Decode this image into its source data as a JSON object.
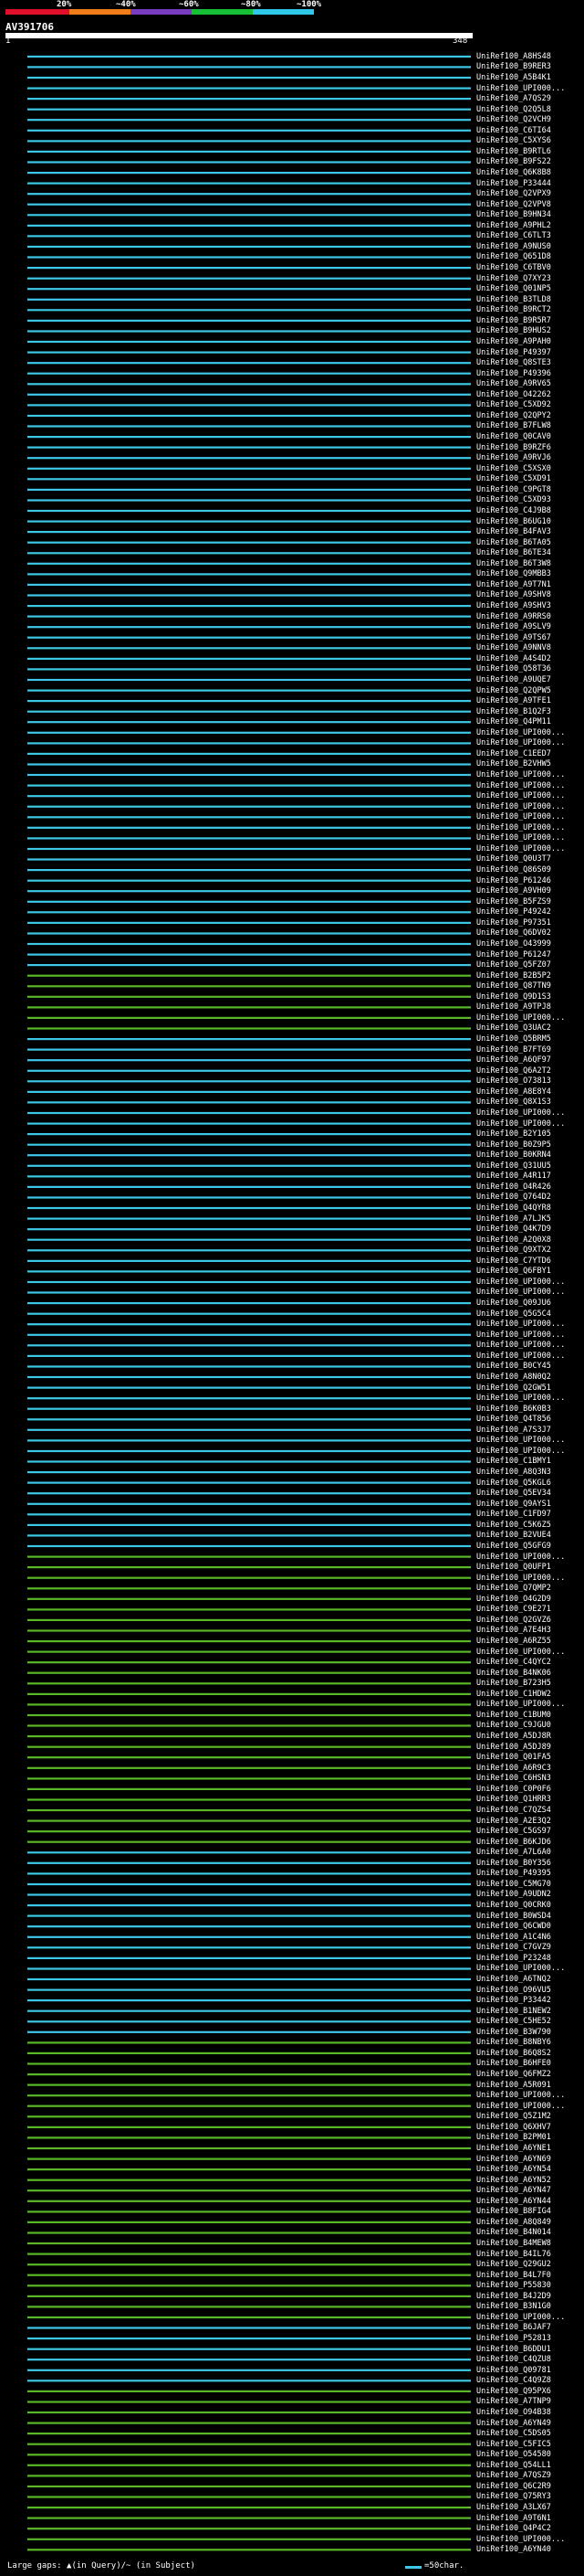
{
  "header": {
    "percent_labels": [
      "20%",
      "~40%",
      "~60%",
      "~80%",
      "~100%"
    ],
    "percent_colors": [
      "#e0102a",
      "#f07c1a",
      "#7a3cbf",
      "#18c038",
      "#30c8e8"
    ],
    "query_id": "AV391706",
    "start_tick": "1",
    "end_tick": "348"
  },
  "colors": {
    "cyan": "#3cc8e6",
    "green": "#5ab828",
    "background": "#000000"
  },
  "hits": [
    {
      "label": "UniRef100_A8HS48",
      "color": "cyan"
    },
    {
      "label": "UniRef100_B9RER3",
      "color": "cyan"
    },
    {
      "label": "UniRef100_A5B4K1",
      "color": "cyan"
    },
    {
      "label": "UniRef100_UPI000...",
      "color": "cyan"
    },
    {
      "label": "UniRef100_A7QS29",
      "color": "cyan"
    },
    {
      "label": "UniRef100_Q2Q5L8",
      "color": "cyan"
    },
    {
      "label": "UniRef100_Q2VCH9",
      "color": "cyan"
    },
    {
      "label": "UniRef100_C6TI64",
      "color": "cyan"
    },
    {
      "label": "UniRef100_C5XYS6",
      "color": "cyan"
    },
    {
      "label": "UniRef100_B9RTL6",
      "color": "cyan"
    },
    {
      "label": "UniRef100_B9FS22",
      "color": "cyan"
    },
    {
      "label": "UniRef100_Q6K8B8",
      "color": "cyan"
    },
    {
      "label": "UniRef100_P33444",
      "color": "cyan"
    },
    {
      "label": "UniRef100_Q2VPX9",
      "color": "cyan"
    },
    {
      "label": "UniRef100_Q2VPV8",
      "color": "cyan"
    },
    {
      "label": "UniRef100_B9HN34",
      "color": "cyan"
    },
    {
      "label": "UniRef100_A9PHL2",
      "color": "cyan"
    },
    {
      "label": "UniRef100_C6TLT3",
      "color": "cyan"
    },
    {
      "label": "UniRef100_A9NUS0",
      "color": "cyan"
    },
    {
      "label": "UniRef100_Q651D8",
      "color": "cyan"
    },
    {
      "label": "UniRef100_C6TBV0",
      "color": "cyan"
    },
    {
      "label": "UniRef100_Q7XY23",
      "color": "cyan"
    },
    {
      "label": "UniRef100_Q01NP5",
      "color": "cyan"
    },
    {
      "label": "UniRef100_B3TLD8",
      "color": "cyan"
    },
    {
      "label": "UniRef100_B9RCT2",
      "color": "cyan"
    },
    {
      "label": "UniRef100_B9R5R7",
      "color": "cyan"
    },
    {
      "label": "UniRef100_B9HUS2",
      "color": "cyan"
    },
    {
      "label": "UniRef100_A9PAH0",
      "color": "cyan"
    },
    {
      "label": "UniRef100_P49397",
      "color": "cyan"
    },
    {
      "label": "UniRef100_Q8STE3",
      "color": "cyan"
    },
    {
      "label": "UniRef100_P49396",
      "color": "cyan"
    },
    {
      "label": "UniRef100_A9RV65",
      "color": "cyan"
    },
    {
      "label": "UniRef100_O42262",
      "color": "cyan"
    },
    {
      "label": "UniRef100_C5XD92",
      "color": "cyan"
    },
    {
      "label": "UniRef100_Q2QPY2",
      "color": "cyan"
    },
    {
      "label": "UniRef100_B7FLW8",
      "color": "cyan"
    },
    {
      "label": "UniRef100_Q0CAV0",
      "color": "cyan"
    },
    {
      "label": "UniRef100_B9RZF6",
      "color": "cyan"
    },
    {
      "label": "UniRef100_A9RVJ6",
      "color": "cyan"
    },
    {
      "label": "UniRef100_C5XSX0",
      "color": "cyan"
    },
    {
      "label": "UniRef100_C5XD91",
      "color": "cyan"
    },
    {
      "label": "UniRef100_C9PGT8",
      "color": "cyan"
    },
    {
      "label": "UniRef100_C5XD93",
      "color": "cyan"
    },
    {
      "label": "UniRef100_C4J9B8",
      "color": "cyan"
    },
    {
      "label": "UniRef100_B6UG10",
      "color": "cyan"
    },
    {
      "label": "UniRef100_B4FAV3",
      "color": "cyan"
    },
    {
      "label": "UniRef100_B6TA05",
      "color": "cyan"
    },
    {
      "label": "UniRef100_B6TE34",
      "color": "cyan"
    },
    {
      "label": "UniRef100_B6T3W8",
      "color": "cyan"
    },
    {
      "label": "UniRef100_Q9MBB3",
      "color": "cyan"
    },
    {
      "label": "UniRef100_A9T7N1",
      "color": "cyan"
    },
    {
      "label": "UniRef100_A9SHV8",
      "color": "cyan"
    },
    {
      "label": "UniRef100_A9SHV3",
      "color": "cyan"
    },
    {
      "label": "UniRef100_A9RRS0",
      "color": "cyan"
    },
    {
      "label": "UniRef100_A9SLV9",
      "color": "cyan"
    },
    {
      "label": "UniRef100_A9TS67",
      "color": "cyan"
    },
    {
      "label": "UniRef100_A9NNV8",
      "color": "cyan"
    },
    {
      "label": "UniRef100_A4S4D2",
      "color": "cyan"
    },
    {
      "label": "UniRef100_Q58T36",
      "color": "cyan"
    },
    {
      "label": "UniRef100_A9UQE7",
      "color": "cyan"
    },
    {
      "label": "UniRef100_Q2QPW5",
      "color": "cyan"
    },
    {
      "label": "UniRef100_A9TFE1",
      "color": "cyan"
    },
    {
      "label": "UniRef100_B1Q2F3",
      "color": "cyan"
    },
    {
      "label": "UniRef100_Q4PM11",
      "color": "cyan"
    },
    {
      "label": "UniRef100_UPI000...",
      "color": "cyan"
    },
    {
      "label": "UniRef100_UPI000...",
      "color": "cyan"
    },
    {
      "label": "UniRef100_C1EED7",
      "color": "cyan"
    },
    {
      "label": "UniRef100_B2VHW5",
      "color": "cyan"
    },
    {
      "label": "UniRef100_UPI000...",
      "color": "cyan"
    },
    {
      "label": "UniRef100_UPI000...",
      "color": "cyan"
    },
    {
      "label": "UniRef100_UPI000...",
      "color": "cyan"
    },
    {
      "label": "UniRef100_UPI000...",
      "color": "cyan"
    },
    {
      "label": "UniRef100_UPI000...",
      "color": "cyan"
    },
    {
      "label": "UniRef100_UPI000...",
      "color": "cyan"
    },
    {
      "label": "UniRef100_UPI000...",
      "color": "cyan"
    },
    {
      "label": "UniRef100_UPI000...",
      "color": "cyan"
    },
    {
      "label": "UniRef100_Q0U3T7",
      "color": "cyan"
    },
    {
      "label": "UniRef100_Q86S09",
      "color": "cyan"
    },
    {
      "label": "UniRef100_P61246",
      "color": "cyan"
    },
    {
      "label": "UniRef100_A9VH09",
      "color": "cyan"
    },
    {
      "label": "UniRef100_B5FZS9",
      "color": "cyan"
    },
    {
      "label": "UniRef100_P49242",
      "color": "cyan"
    },
    {
      "label": "UniRef100_P97351",
      "color": "cyan"
    },
    {
      "label": "UniRef100_Q6DV02",
      "color": "cyan"
    },
    {
      "label": "UniRef100_O43999",
      "color": "cyan"
    },
    {
      "label": "UniRef100_P61247",
      "color": "cyan"
    },
    {
      "label": "UniRef100_Q5FZ07",
      "color": "cyan"
    },
    {
      "label": "UniRef100_B2B5P2",
      "color": "green"
    },
    {
      "label": "UniRef100_Q87TN9",
      "color": "green"
    },
    {
      "label": "UniRef100_Q9D1S3",
      "color": "green"
    },
    {
      "label": "UniRef100_A9TPJ8",
      "color": "green"
    },
    {
      "label": "UniRef100_UPI000...",
      "color": "green"
    },
    {
      "label": "UniRef100_Q3UAC2",
      "color": "green"
    },
    {
      "label": "UniRef100_Q5BRM5",
      "color": "cyan"
    },
    {
      "label": "UniRef100_B7FT69",
      "color": "cyan"
    },
    {
      "label": "UniRef100_A6QF97",
      "color": "cyan"
    },
    {
      "label": "UniRef100_Q6A2T2",
      "color": "cyan"
    },
    {
      "label": "UniRef100_O73813",
      "color": "cyan"
    },
    {
      "label": "UniRef100_A8E8Y4",
      "color": "cyan"
    },
    {
      "label": "UniRef100_Q8X1S3",
      "color": "cyan"
    },
    {
      "label": "UniRef100_UPI000...",
      "color": "cyan"
    },
    {
      "label": "UniRef100_UPI000...",
      "color": "cyan"
    },
    {
      "label": "UniRef100_B2Y105",
      "color": "cyan"
    },
    {
      "label": "UniRef100_B0Z9P5",
      "color": "cyan"
    },
    {
      "label": "UniRef100_B0KRN4",
      "color": "cyan"
    },
    {
      "label": "UniRef100_Q31UU5",
      "color": "cyan"
    },
    {
      "label": "UniRef100_A4R117",
      "color": "cyan"
    },
    {
      "label": "UniRef100_O4R426",
      "color": "cyan"
    },
    {
      "label": "UniRef100_Q764D2",
      "color": "cyan"
    },
    {
      "label": "UniRef100_Q4QYR8",
      "color": "cyan"
    },
    {
      "label": "UniRef100_A7LJK5",
      "color": "cyan"
    },
    {
      "label": "UniRef100_Q4K7D9",
      "color": "cyan"
    },
    {
      "label": "UniRef100_A2Q0X8",
      "color": "cyan"
    },
    {
      "label": "UniRef100_Q9XTX2",
      "color": "cyan"
    },
    {
      "label": "UniRef100_C7YTD6",
      "color": "cyan"
    },
    {
      "label": "UniRef100_Q6FBY1",
      "color": "cyan"
    },
    {
      "label": "UniRef100_UPI000...",
      "color": "cyan"
    },
    {
      "label": "UniRef100_UPI000...",
      "color": "cyan"
    },
    {
      "label": "UniRef100_Q09JU6",
      "color": "cyan"
    },
    {
      "label": "UniRef100_Q5G5C4",
      "color": "cyan"
    },
    {
      "label": "UniRef100_UPI000...",
      "color": "cyan"
    },
    {
      "label": "UniRef100_UPI000...",
      "color": "cyan"
    },
    {
      "label": "UniRef100_UPI000...",
      "color": "cyan"
    },
    {
      "label": "UniRef100_UPI000...",
      "color": "cyan"
    },
    {
      "label": "UniRef100_B0CY45",
      "color": "cyan"
    },
    {
      "label": "UniRef100_A8N0Q2",
      "color": "cyan"
    },
    {
      "label": "UniRef100_Q2GW51",
      "color": "cyan"
    },
    {
      "label": "UniRef100_UPI000...",
      "color": "cyan"
    },
    {
      "label": "UniRef100_B6K0B3",
      "color": "cyan"
    },
    {
      "label": "UniRef100_Q4T856",
      "color": "cyan"
    },
    {
      "label": "UniRef100_A7S3J7",
      "color": "cyan"
    },
    {
      "label": "UniRef100_UPI000...",
      "color": "cyan"
    },
    {
      "label": "UniRef100_UPI000...",
      "color": "cyan"
    },
    {
      "label": "UniRef100_C1BMY1",
      "color": "cyan"
    },
    {
      "label": "UniRef100_A8Q3N3",
      "color": "cyan"
    },
    {
      "label": "UniRef100_Q5KGL6",
      "color": "cyan"
    },
    {
      "label": "UniRef100_Q5EV34",
      "color": "cyan"
    },
    {
      "label": "UniRef100_Q9AYS1",
      "color": "cyan"
    },
    {
      "label": "UniRef100_C1FD97",
      "color": "cyan"
    },
    {
      "label": "UniRef100_C5K6Z5",
      "color": "cyan"
    },
    {
      "label": "UniRef100_B2VUE4",
      "color": "cyan"
    },
    {
      "label": "UniRef100_Q5GFG9",
      "color": "cyan"
    },
    {
      "label": "UniRef100_UPI000...",
      "color": "green"
    },
    {
      "label": "UniRef100_Q0UFP1",
      "color": "green"
    },
    {
      "label": "UniRef100_UPI000...",
      "color": "green"
    },
    {
      "label": "UniRef100_Q7QMP2",
      "color": "green"
    },
    {
      "label": "UniRef100_O4G2D9",
      "color": "green"
    },
    {
      "label": "UniRef100_C9E271",
      "color": "green"
    },
    {
      "label": "UniRef100_Q2GVZ6",
      "color": "green"
    },
    {
      "label": "UniRef100_A7E4H3",
      "color": "green"
    },
    {
      "label": "UniRef100_A6RZ55",
      "color": "green"
    },
    {
      "label": "UniRef100_UPI000...",
      "color": "green"
    },
    {
      "label": "UniRef100_C4QYC2",
      "color": "green"
    },
    {
      "label": "UniRef100_B4NK06",
      "color": "green"
    },
    {
      "label": "UniRef100_B723H5",
      "color": "green"
    },
    {
      "label": "UniRef100_C1HDW2",
      "color": "green"
    },
    {
      "label": "UniRef100_UPI000...",
      "color": "green"
    },
    {
      "label": "UniRef100_C1BUM0",
      "color": "green"
    },
    {
      "label": "UniRef100_C9JGU0",
      "color": "green"
    },
    {
      "label": "UniRef100_A5DJ8R",
      "color": "green"
    },
    {
      "label": "UniRef100_A5DJ89",
      "color": "green"
    },
    {
      "label": "UniRef100_Q01FA5",
      "color": "green"
    },
    {
      "label": "UniRef100_A6R9C3",
      "color": "green"
    },
    {
      "label": "UniRef100_C6HSN3",
      "color": "green"
    },
    {
      "label": "UniRef100_C0P0F6",
      "color": "green"
    },
    {
      "label": "UniRef100_Q1HRR3",
      "color": "green"
    },
    {
      "label": "UniRef100_C7QZS4",
      "color": "green"
    },
    {
      "label": "UniRef100_A2E3Q2",
      "color": "green"
    },
    {
      "label": "UniRef100_C5GS97",
      "color": "green"
    },
    {
      "label": "UniRef100_B6KJD6",
      "color": "green"
    },
    {
      "label": "UniRef100_A7L6A0",
      "color": "cyan"
    },
    {
      "label": "UniRef100_B0Y356",
      "color": "cyan"
    },
    {
      "label": "UniRef100_P49395",
      "color": "cyan"
    },
    {
      "label": "UniRef100_C5MG70",
      "color": "cyan"
    },
    {
      "label": "UniRef100_A9UDN2",
      "color": "cyan"
    },
    {
      "label": "UniRef100_Q0CRK0",
      "color": "cyan"
    },
    {
      "label": "UniRef100_B0WSD4",
      "color": "cyan"
    },
    {
      "label": "UniRef100_Q6CWD0",
      "color": "cyan"
    },
    {
      "label": "UniRef100_A1C4N6",
      "color": "cyan"
    },
    {
      "label": "UniRef100_C7GVZ9",
      "color": "cyan"
    },
    {
      "label": "UniRef100_P23248",
      "color": "cyan"
    },
    {
      "label": "UniRef100_UPI000...",
      "color": "cyan"
    },
    {
      "label": "UniRef100_A6TNQ2",
      "color": "cyan"
    },
    {
      "label": "UniRef100_O96VU5",
      "color": "cyan"
    },
    {
      "label": "UniRef100_P33442",
      "color": "cyan"
    },
    {
      "label": "UniRef100_B1NEW2",
      "color": "cyan"
    },
    {
      "label": "UniRef100_C5HE52",
      "color": "cyan"
    },
    {
      "label": "UniRef100_B3W790",
      "color": "cyan"
    },
    {
      "label": "UniRef100_B8NBY6",
      "color": "green"
    },
    {
      "label": "UniRef100_B6Q8S2",
      "color": "green"
    },
    {
      "label": "UniRef100_B6HFE0",
      "color": "green"
    },
    {
      "label": "UniRef100_Q6FMZ2",
      "color": "green"
    },
    {
      "label": "UniRef100_A5R091",
      "color": "green"
    },
    {
      "label": "UniRef100_UPI000...",
      "color": "green"
    },
    {
      "label": "UniRef100_UPI000...",
      "color": "green"
    },
    {
      "label": "UniRef100_Q5Z1M2",
      "color": "green"
    },
    {
      "label": "UniRef100_Q6XHV7",
      "color": "green"
    },
    {
      "label": "UniRef100_B2PM01",
      "color": "green"
    },
    {
      "label": "UniRef100_A6YNE1",
      "color": "green"
    },
    {
      "label": "UniRef100_A6YN69",
      "color": "green"
    },
    {
      "label": "UniRef100_A6YN54",
      "color": "green"
    },
    {
      "label": "UniRef100_A6YN52",
      "color": "green"
    },
    {
      "label": "UniRef100_A6YN47",
      "color": "green"
    },
    {
      "label": "UniRef100_A6YN44",
      "color": "green"
    },
    {
      "label": "UniRef100_B8FIG4",
      "color": "green"
    },
    {
      "label": "UniRef100_A8Q849",
      "color": "green"
    },
    {
      "label": "UniRef100_B4N014",
      "color": "green"
    },
    {
      "label": "UniRef100_B4MEW8",
      "color": "green"
    },
    {
      "label": "UniRef100_B4IL76",
      "color": "green"
    },
    {
      "label": "UniRef100_Q29GU2",
      "color": "green"
    },
    {
      "label": "UniRef100_B4L7F0",
      "color": "green"
    },
    {
      "label": "UniRef100_P55830",
      "color": "green"
    },
    {
      "label": "UniRef100_B4J2D9",
      "color": "green"
    },
    {
      "label": "UniRef100_B3N1G0",
      "color": "green"
    },
    {
      "label": "UniRef100_UPI000...",
      "color": "green"
    },
    {
      "label": "UniRef100_B6JAF7",
      "color": "cyan"
    },
    {
      "label": "UniRef100_P52813",
      "color": "cyan"
    },
    {
      "label": "UniRef100_B6DDU1",
      "color": "cyan"
    },
    {
      "label": "UniRef100_C4QZU8",
      "color": "cyan"
    },
    {
      "label": "UniRef100_Q09781",
      "color": "cyan"
    },
    {
      "label": "UniRef100_C4Q9Z8",
      "color": "cyan"
    },
    {
      "label": "UniRef100_Q95PX6",
      "color": "green"
    },
    {
      "label": "UniRef100_A7TNP9",
      "color": "green"
    },
    {
      "label": "UniRef100_O94B38",
      "color": "green"
    },
    {
      "label": "UniRef100_A6YN49",
      "color": "green"
    },
    {
      "label": "UniRef100_C5DS05",
      "color": "green"
    },
    {
      "label": "UniRef100_C5FIC5",
      "color": "green"
    },
    {
      "label": "UniRef100_O54580",
      "color": "green"
    },
    {
      "label": "UniRef100_Q54LL1",
      "color": "green"
    },
    {
      "label": "UniRef100_A7QSZ9",
      "color": "green"
    },
    {
      "label": "UniRef100_Q6C2R9",
      "color": "green"
    },
    {
      "label": "UniRef100_Q75RY3",
      "color": "green"
    },
    {
      "label": "UniRef100_A3LX67",
      "color": "green"
    },
    {
      "label": "UniRef100_A9T6N1",
      "color": "green"
    },
    {
      "label": "UniRef100_Q4P4C2",
      "color": "green"
    },
    {
      "label": "UniRef100_UPI000...",
      "color": "green"
    },
    {
      "label": "UniRef100_A6YN40",
      "color": "green"
    }
  ],
  "footer": {
    "legend": "Large gaps: ▲(in Query)/~ (in Subject)",
    "scale": "=50char."
  }
}
